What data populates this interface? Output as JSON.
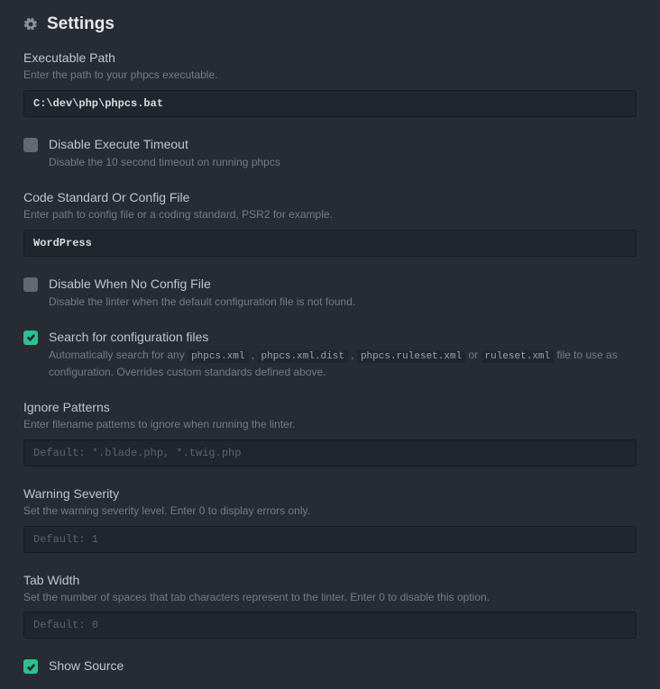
{
  "header": {
    "title": "Settings"
  },
  "executablePath": {
    "title": "Executable Path",
    "desc": "Enter the path to your phpcs executable.",
    "value": "C:\\dev\\php\\phpcs.bat"
  },
  "disableTimeout": {
    "title": "Disable Execute Timeout",
    "desc": "Disable the 10 second timeout on running phpcs"
  },
  "codeStandard": {
    "title": "Code Standard Or Config File",
    "desc": "Enter path to config file or a coding standard, PSR2 for example.",
    "value": "WordPress"
  },
  "disableNoConfig": {
    "title": "Disable When No Config File",
    "desc": "Disable the linter when the default configuration file is not found."
  },
  "searchConfig": {
    "title": "Search for configuration files",
    "descPre": "Automatically search for any ",
    "c1": "phpcs.xml",
    "c2": "phpcs.xml.dist",
    "c3": "phpcs.ruleset.xml",
    "c4": "ruleset.xml",
    "sep": " , ",
    "or": " or ",
    "descPost": " file to use as configuration. Overrides custom standards defined above."
  },
  "ignorePatterns": {
    "title": "Ignore Patterns",
    "desc": "Enter filename patterns to ignore when running the linter.",
    "placeholder": "Default: *.blade.php, *.twig.php"
  },
  "warningSeverity": {
    "title": "Warning Severity",
    "desc": "Set the warning severity level. Enter 0 to display errors only.",
    "placeholder": "Default: 1"
  },
  "tabWidth": {
    "title": "Tab Width",
    "desc": "Set the number of spaces that tab characters represent to the linter. Enter 0 to disable this option.",
    "placeholder": "Default: 0"
  },
  "showSource": {
    "title": "Show Source"
  }
}
